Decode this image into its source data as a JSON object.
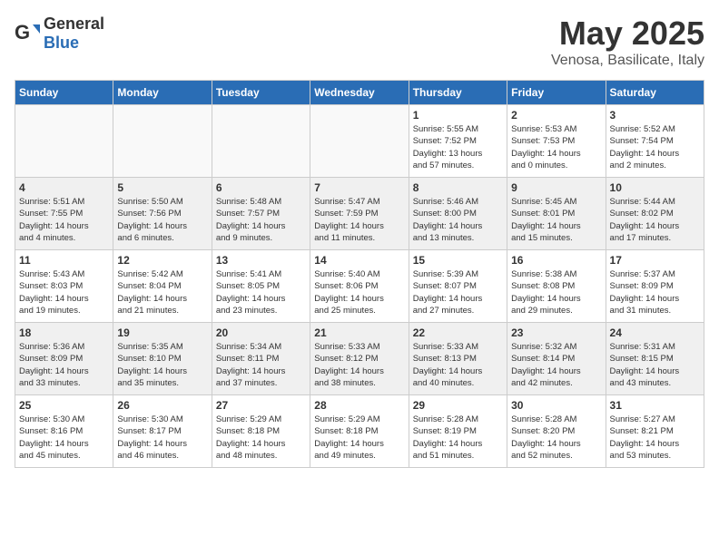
{
  "header": {
    "logo_general": "General",
    "logo_blue": "Blue",
    "month": "May 2025",
    "location": "Venosa, Basilicate, Italy"
  },
  "days_of_week": [
    "Sunday",
    "Monday",
    "Tuesday",
    "Wednesday",
    "Thursday",
    "Friday",
    "Saturday"
  ],
  "weeks": [
    [
      {
        "day": "",
        "info": ""
      },
      {
        "day": "",
        "info": ""
      },
      {
        "day": "",
        "info": ""
      },
      {
        "day": "",
        "info": ""
      },
      {
        "day": "1",
        "info": "Sunrise: 5:55 AM\nSunset: 7:52 PM\nDaylight: 13 hours\nand 57 minutes."
      },
      {
        "day": "2",
        "info": "Sunrise: 5:53 AM\nSunset: 7:53 PM\nDaylight: 14 hours\nand 0 minutes."
      },
      {
        "day": "3",
        "info": "Sunrise: 5:52 AM\nSunset: 7:54 PM\nDaylight: 14 hours\nand 2 minutes."
      }
    ],
    [
      {
        "day": "4",
        "info": "Sunrise: 5:51 AM\nSunset: 7:55 PM\nDaylight: 14 hours\nand 4 minutes."
      },
      {
        "day": "5",
        "info": "Sunrise: 5:50 AM\nSunset: 7:56 PM\nDaylight: 14 hours\nand 6 minutes."
      },
      {
        "day": "6",
        "info": "Sunrise: 5:48 AM\nSunset: 7:57 PM\nDaylight: 14 hours\nand 9 minutes."
      },
      {
        "day": "7",
        "info": "Sunrise: 5:47 AM\nSunset: 7:59 PM\nDaylight: 14 hours\nand 11 minutes."
      },
      {
        "day": "8",
        "info": "Sunrise: 5:46 AM\nSunset: 8:00 PM\nDaylight: 14 hours\nand 13 minutes."
      },
      {
        "day": "9",
        "info": "Sunrise: 5:45 AM\nSunset: 8:01 PM\nDaylight: 14 hours\nand 15 minutes."
      },
      {
        "day": "10",
        "info": "Sunrise: 5:44 AM\nSunset: 8:02 PM\nDaylight: 14 hours\nand 17 minutes."
      }
    ],
    [
      {
        "day": "11",
        "info": "Sunrise: 5:43 AM\nSunset: 8:03 PM\nDaylight: 14 hours\nand 19 minutes."
      },
      {
        "day": "12",
        "info": "Sunrise: 5:42 AM\nSunset: 8:04 PM\nDaylight: 14 hours\nand 21 minutes."
      },
      {
        "day": "13",
        "info": "Sunrise: 5:41 AM\nSunset: 8:05 PM\nDaylight: 14 hours\nand 23 minutes."
      },
      {
        "day": "14",
        "info": "Sunrise: 5:40 AM\nSunset: 8:06 PM\nDaylight: 14 hours\nand 25 minutes."
      },
      {
        "day": "15",
        "info": "Sunrise: 5:39 AM\nSunset: 8:07 PM\nDaylight: 14 hours\nand 27 minutes."
      },
      {
        "day": "16",
        "info": "Sunrise: 5:38 AM\nSunset: 8:08 PM\nDaylight: 14 hours\nand 29 minutes."
      },
      {
        "day": "17",
        "info": "Sunrise: 5:37 AM\nSunset: 8:09 PM\nDaylight: 14 hours\nand 31 minutes."
      }
    ],
    [
      {
        "day": "18",
        "info": "Sunrise: 5:36 AM\nSunset: 8:09 PM\nDaylight: 14 hours\nand 33 minutes."
      },
      {
        "day": "19",
        "info": "Sunrise: 5:35 AM\nSunset: 8:10 PM\nDaylight: 14 hours\nand 35 minutes."
      },
      {
        "day": "20",
        "info": "Sunrise: 5:34 AM\nSunset: 8:11 PM\nDaylight: 14 hours\nand 37 minutes."
      },
      {
        "day": "21",
        "info": "Sunrise: 5:33 AM\nSunset: 8:12 PM\nDaylight: 14 hours\nand 38 minutes."
      },
      {
        "day": "22",
        "info": "Sunrise: 5:33 AM\nSunset: 8:13 PM\nDaylight: 14 hours\nand 40 minutes."
      },
      {
        "day": "23",
        "info": "Sunrise: 5:32 AM\nSunset: 8:14 PM\nDaylight: 14 hours\nand 42 minutes."
      },
      {
        "day": "24",
        "info": "Sunrise: 5:31 AM\nSunset: 8:15 PM\nDaylight: 14 hours\nand 43 minutes."
      }
    ],
    [
      {
        "day": "25",
        "info": "Sunrise: 5:30 AM\nSunset: 8:16 PM\nDaylight: 14 hours\nand 45 minutes."
      },
      {
        "day": "26",
        "info": "Sunrise: 5:30 AM\nSunset: 8:17 PM\nDaylight: 14 hours\nand 46 minutes."
      },
      {
        "day": "27",
        "info": "Sunrise: 5:29 AM\nSunset: 8:18 PM\nDaylight: 14 hours\nand 48 minutes."
      },
      {
        "day": "28",
        "info": "Sunrise: 5:29 AM\nSunset: 8:18 PM\nDaylight: 14 hours\nand 49 minutes."
      },
      {
        "day": "29",
        "info": "Sunrise: 5:28 AM\nSunset: 8:19 PM\nDaylight: 14 hours\nand 51 minutes."
      },
      {
        "day": "30",
        "info": "Sunrise: 5:28 AM\nSunset: 8:20 PM\nDaylight: 14 hours\nand 52 minutes."
      },
      {
        "day": "31",
        "info": "Sunrise: 5:27 AM\nSunset: 8:21 PM\nDaylight: 14 hours\nand 53 minutes."
      }
    ]
  ]
}
